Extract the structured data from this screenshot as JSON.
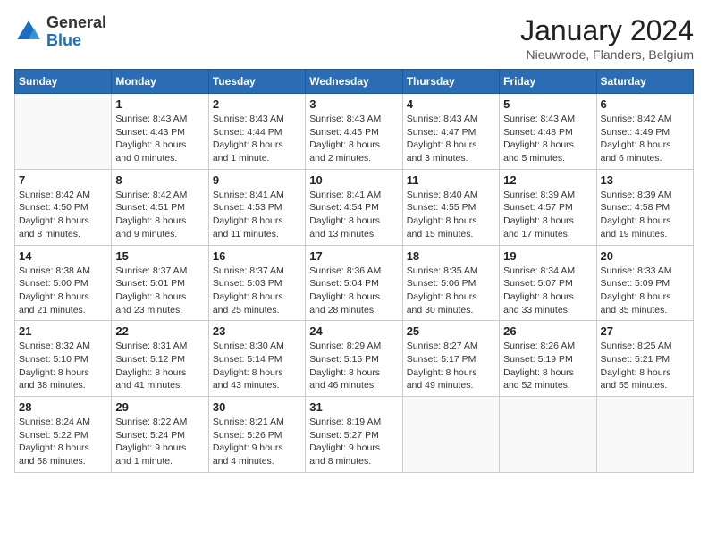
{
  "header": {
    "logo_general": "General",
    "logo_blue": "Blue",
    "month_title": "January 2024",
    "location": "Nieuwrode, Flanders, Belgium"
  },
  "days_of_week": [
    "Sunday",
    "Monday",
    "Tuesday",
    "Wednesday",
    "Thursday",
    "Friday",
    "Saturday"
  ],
  "weeks": [
    [
      {
        "day": "",
        "info": ""
      },
      {
        "day": "1",
        "info": "Sunrise: 8:43 AM\nSunset: 4:43 PM\nDaylight: 8 hours\nand 0 minutes."
      },
      {
        "day": "2",
        "info": "Sunrise: 8:43 AM\nSunset: 4:44 PM\nDaylight: 8 hours\nand 1 minute."
      },
      {
        "day": "3",
        "info": "Sunrise: 8:43 AM\nSunset: 4:45 PM\nDaylight: 8 hours\nand 2 minutes."
      },
      {
        "day": "4",
        "info": "Sunrise: 8:43 AM\nSunset: 4:47 PM\nDaylight: 8 hours\nand 3 minutes."
      },
      {
        "day": "5",
        "info": "Sunrise: 8:43 AM\nSunset: 4:48 PM\nDaylight: 8 hours\nand 5 minutes."
      },
      {
        "day": "6",
        "info": "Sunrise: 8:42 AM\nSunset: 4:49 PM\nDaylight: 8 hours\nand 6 minutes."
      }
    ],
    [
      {
        "day": "7",
        "info": "Sunrise: 8:42 AM\nSunset: 4:50 PM\nDaylight: 8 hours\nand 8 minutes."
      },
      {
        "day": "8",
        "info": "Sunrise: 8:42 AM\nSunset: 4:51 PM\nDaylight: 8 hours\nand 9 minutes."
      },
      {
        "day": "9",
        "info": "Sunrise: 8:41 AM\nSunset: 4:53 PM\nDaylight: 8 hours\nand 11 minutes."
      },
      {
        "day": "10",
        "info": "Sunrise: 8:41 AM\nSunset: 4:54 PM\nDaylight: 8 hours\nand 13 minutes."
      },
      {
        "day": "11",
        "info": "Sunrise: 8:40 AM\nSunset: 4:55 PM\nDaylight: 8 hours\nand 15 minutes."
      },
      {
        "day": "12",
        "info": "Sunrise: 8:39 AM\nSunset: 4:57 PM\nDaylight: 8 hours\nand 17 minutes."
      },
      {
        "day": "13",
        "info": "Sunrise: 8:39 AM\nSunset: 4:58 PM\nDaylight: 8 hours\nand 19 minutes."
      }
    ],
    [
      {
        "day": "14",
        "info": "Sunrise: 8:38 AM\nSunset: 5:00 PM\nDaylight: 8 hours\nand 21 minutes."
      },
      {
        "day": "15",
        "info": "Sunrise: 8:37 AM\nSunset: 5:01 PM\nDaylight: 8 hours\nand 23 minutes."
      },
      {
        "day": "16",
        "info": "Sunrise: 8:37 AM\nSunset: 5:03 PM\nDaylight: 8 hours\nand 25 minutes."
      },
      {
        "day": "17",
        "info": "Sunrise: 8:36 AM\nSunset: 5:04 PM\nDaylight: 8 hours\nand 28 minutes."
      },
      {
        "day": "18",
        "info": "Sunrise: 8:35 AM\nSunset: 5:06 PM\nDaylight: 8 hours\nand 30 minutes."
      },
      {
        "day": "19",
        "info": "Sunrise: 8:34 AM\nSunset: 5:07 PM\nDaylight: 8 hours\nand 33 minutes."
      },
      {
        "day": "20",
        "info": "Sunrise: 8:33 AM\nSunset: 5:09 PM\nDaylight: 8 hours\nand 35 minutes."
      }
    ],
    [
      {
        "day": "21",
        "info": "Sunrise: 8:32 AM\nSunset: 5:10 PM\nDaylight: 8 hours\nand 38 minutes."
      },
      {
        "day": "22",
        "info": "Sunrise: 8:31 AM\nSunset: 5:12 PM\nDaylight: 8 hours\nand 41 minutes."
      },
      {
        "day": "23",
        "info": "Sunrise: 8:30 AM\nSunset: 5:14 PM\nDaylight: 8 hours\nand 43 minutes."
      },
      {
        "day": "24",
        "info": "Sunrise: 8:29 AM\nSunset: 5:15 PM\nDaylight: 8 hours\nand 46 minutes."
      },
      {
        "day": "25",
        "info": "Sunrise: 8:27 AM\nSunset: 5:17 PM\nDaylight: 8 hours\nand 49 minutes."
      },
      {
        "day": "26",
        "info": "Sunrise: 8:26 AM\nSunset: 5:19 PM\nDaylight: 8 hours\nand 52 minutes."
      },
      {
        "day": "27",
        "info": "Sunrise: 8:25 AM\nSunset: 5:21 PM\nDaylight: 8 hours\nand 55 minutes."
      }
    ],
    [
      {
        "day": "28",
        "info": "Sunrise: 8:24 AM\nSunset: 5:22 PM\nDaylight: 8 hours\nand 58 minutes."
      },
      {
        "day": "29",
        "info": "Sunrise: 8:22 AM\nSunset: 5:24 PM\nDaylight: 9 hours\nand 1 minute."
      },
      {
        "day": "30",
        "info": "Sunrise: 8:21 AM\nSunset: 5:26 PM\nDaylight: 9 hours\nand 4 minutes."
      },
      {
        "day": "31",
        "info": "Sunrise: 8:19 AM\nSunset: 5:27 PM\nDaylight: 9 hours\nand 8 minutes."
      },
      {
        "day": "",
        "info": ""
      },
      {
        "day": "",
        "info": ""
      },
      {
        "day": "",
        "info": ""
      }
    ]
  ]
}
